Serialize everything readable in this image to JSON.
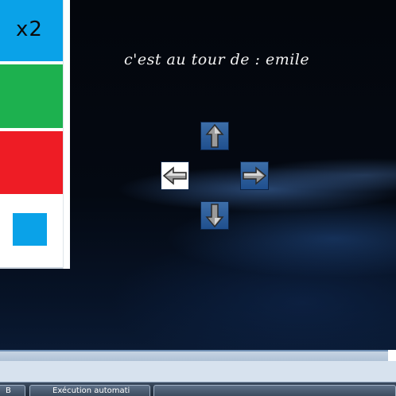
{
  "side_panel": {
    "multiplier_label": "x2",
    "colors": {
      "blue": "#0aa2e8",
      "green": "#1db14f",
      "red": "#ee1c25",
      "white": "#ffffff"
    }
  },
  "game": {
    "turn_text": "c'est au tour de : emile",
    "arrows": {
      "up": "arrow-up-icon",
      "down": "arrow-down-icon",
      "left": "arrow-left-icon",
      "right": "arrow-right-icon",
      "selected": "left"
    }
  },
  "taskbar": {
    "buttons": [
      {
        "label": "B"
      },
      {
        "label": "Exécution automati"
      },
      {
        "label": ""
      }
    ]
  }
}
